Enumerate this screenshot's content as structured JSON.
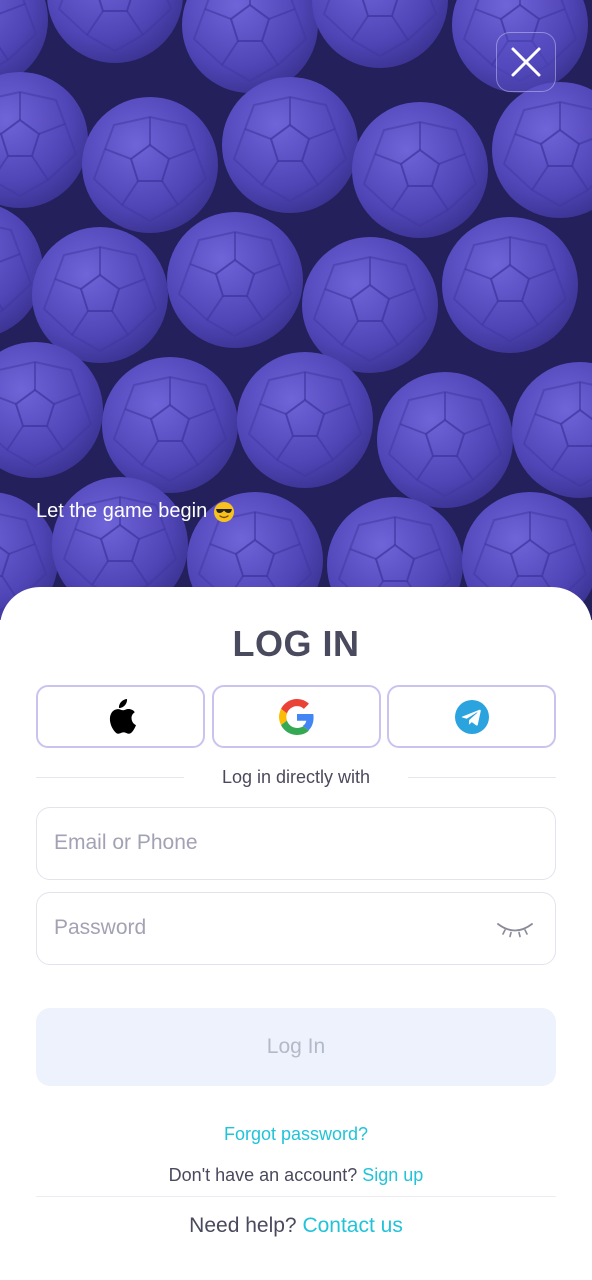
{
  "hero": {
    "tagline": "Let the game begin",
    "close_icon": "close-icon",
    "tagline_emoji": "smiling-face-with-sunglasses-emoji"
  },
  "login": {
    "title": "LOG IN",
    "social": [
      {
        "name": "apple",
        "icon": "apple-icon"
      },
      {
        "name": "google",
        "icon": "google-icon"
      },
      {
        "name": "telegram",
        "icon": "telegram-icon"
      }
    ],
    "divider_label": "Log in directly with",
    "email_placeholder": "Email or Phone",
    "email_value": "",
    "password_placeholder": "Password",
    "password_value": "",
    "password_toggle_icon": "eye-closed-icon",
    "submit_label": "Log In",
    "forgot_label": "Forgot password?",
    "no_account_text": "Don't have an account?",
    "signup_label": "Sign up",
    "help_text": "Need help?",
    "contact_label": "Contact us"
  },
  "colors": {
    "accent": "#21c3d9",
    "hero_bg": "#2e2a72",
    "ball": "#5b4fc4",
    "title": "#4a4a5e",
    "button_disabled_bg": "#edf2fc",
    "social_border": "#c8c4ef"
  }
}
